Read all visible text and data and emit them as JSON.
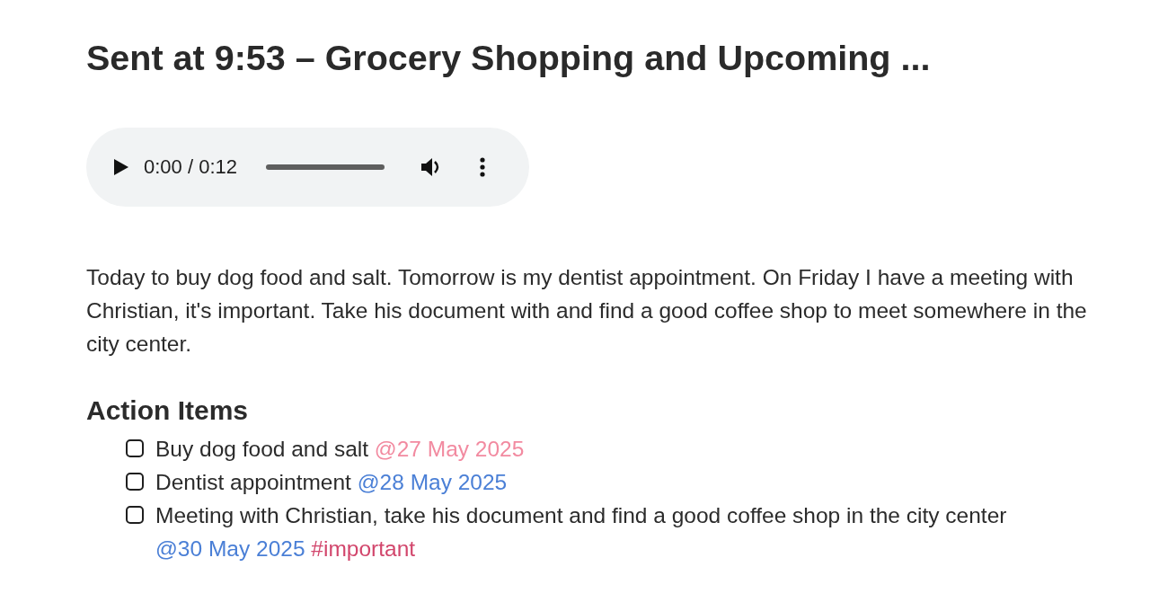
{
  "title": "Sent at 9:53 – Grocery Shopping and Upcoming ...",
  "audio_player": {
    "time": "0:00 / 0:12"
  },
  "transcript": "Today to buy dog food and salt. Tomorrow is my dentist appointment. On Friday I have a meeting with Christian, it's important. Take his document with and find a good coffee shop to meet somewhere in the city center.",
  "action_items": {
    "heading": "Action Items",
    "items": [
      {
        "text": "Buy dog food and salt",
        "checked": false,
        "tags": [
          {
            "text": "@27 May 2025",
            "color": "#f28aa0"
          }
        ]
      },
      {
        "text": "Dentist appointment",
        "checked": false,
        "tags": [
          {
            "text": "@28 May 2025",
            "color": "#4a7fd6"
          }
        ]
      },
      {
        "text": "Meeting with Christian, take his document and find a good coffee shop in the city center",
        "checked": false,
        "tags": [
          {
            "text": "@30 May 2025",
            "color": "#4a7fd6"
          },
          {
            "text": "#important",
            "color": "#d2466c"
          }
        ]
      }
    ]
  }
}
